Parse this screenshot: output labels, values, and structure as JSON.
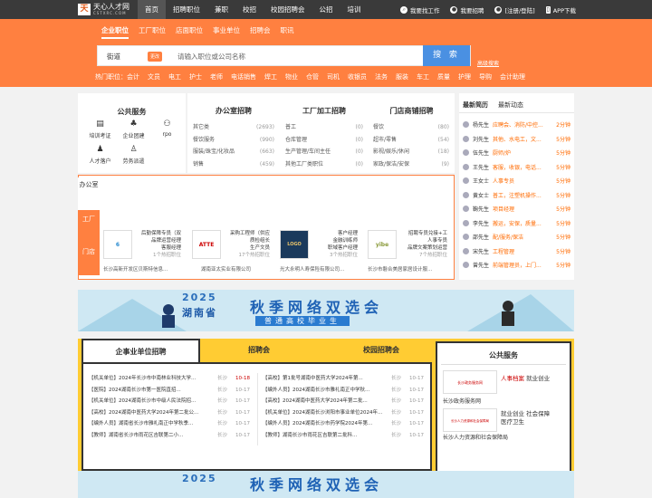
{
  "logo": {
    "mark": "天",
    "name": "天心人才网",
    "url": "CSTXRC.COM"
  },
  "nav": [
    "首页",
    "招聘职位",
    "兼职",
    "校招",
    "校园招聘会",
    "公招",
    "培训"
  ],
  "top_right": {
    "find_job": "我要找工作",
    "hire": "我要招聘",
    "login": "[注册/登陆]",
    "app": "APP下载"
  },
  "search_tabs": [
    "企业职位",
    "工厂职位",
    "店面职位",
    "事业单位",
    "招聘会",
    "职讯"
  ],
  "search": {
    "city": "街道",
    "change": "更改",
    "placeholder": "请输入职位或公司名称",
    "button": "搜 索",
    "advanced": "高级搜索"
  },
  "hot": {
    "label": "热门职位：",
    "items": [
      "会计",
      "文员",
      "电工",
      "护士",
      "老师",
      "电话销售",
      "焊工",
      "物业",
      "仓管",
      "司机",
      "收银员",
      "法务",
      "服装",
      "车工",
      "质量",
      "护理",
      "导购",
      "会计助理"
    ]
  },
  "public_service": {
    "title": "公共服务",
    "items": [
      "培训考证",
      "企业团建",
      "rpo",
      "人才落户",
      "劳务派遣"
    ]
  },
  "office": {
    "title": "办公室招聘",
    "rows": [
      [
        "其它类",
        "(2693)"
      ],
      [
        "餐饮服务",
        "(990)"
      ],
      [
        "服装/珠宝/化妆品",
        "(663)"
      ],
      [
        "销售",
        "(459)"
      ]
    ]
  },
  "factory": {
    "title": "工厂加工招聘",
    "rows": [
      [
        "普工",
        "(0)"
      ],
      [
        "仓库管理",
        "(0)"
      ],
      [
        "生产管理/车间主任",
        "(0)"
      ],
      [
        "其他工厂类职位",
        "(0)"
      ]
    ]
  },
  "shop": {
    "title": "门店商铺招聘",
    "rows": [
      [
        "餐饮",
        "(80)"
      ],
      [
        "超市/零售",
        "(54)"
      ],
      [
        "影视/娱乐/休闲",
        "(18)"
      ],
      [
        "家政/保洁/安保",
        "(9)"
      ]
    ]
  },
  "latest": {
    "tabs": [
      "最新简历",
      "最新动态"
    ],
    "rows": [
      [
        "杨先生",
        "应聘会、消防/中控...",
        "2分钟"
      ],
      [
        "刘先生",
        "其他、水电工，文...",
        "5分钟"
      ],
      [
        "伍先生",
        "厨师/炉",
        "5分钟"
      ],
      [
        "王先生",
        "客服，收银，电话...",
        "5分钟"
      ],
      [
        "王女士",
        "人事专员",
        "5分钟"
      ],
      [
        "黄女士",
        "普工，注塑机操作...",
        "5分钟"
      ],
      [
        "鞠先生",
        "项目经理",
        "5分钟"
      ],
      [
        "李先生",
        "搬运，安保，质量...",
        "5分钟"
      ],
      [
        "邵先生",
        "配/服务/保洁",
        "5分钟"
      ],
      [
        "宋先生",
        "工程管理",
        "5分钟"
      ],
      [
        "曾先生",
        "前端管理员，上门...",
        "5分钟"
      ]
    ]
  },
  "vertical_tabs": [
    "办公室",
    "工厂",
    "门店"
  ],
  "companies": [
    {
      "logo": "6",
      "lines": [
        "后勤保障专员（双",
        "品牌运营经理",
        "客服经理"
      ],
      "more": "1个热招职位",
      "name": "长沙高新开发区贝斯特信息..."
    },
    {
      "logo": "ATTE",
      "lines": [
        "采购工程师（供应",
        "质检组长",
        "生产文员"
      ],
      "more": "17个热招职位",
      "name": "湖南亚太实业有限公司"
    },
    {
      "logo": "LOGO",
      "lines": [
        "客户经理",
        "金融训练师",
        "职域客户经理"
      ],
      "more": "3个热招职位",
      "name": "光大永明人寿保险有限公司..."
    },
    {
      "logo": "yibe",
      "lines": [
        "招聘专员兑接+工",
        "人事专员",
        "品牌文案策划运营"
      ],
      "more": "7个热招职位",
      "name": "长沙市磐合美居家居设计服..."
    }
  ],
  "banner": {
    "year": "2025",
    "province": "湖南省",
    "title": "秋季网络双选会",
    "subtitle": "普通高校毕业生"
  },
  "news_tabs": [
    "企事业单位招聘",
    "招聘会",
    "校园招聘会"
  ],
  "news_left": [
    [
      "【机关单位】2024年长沙市中南林业科技大学...",
      "长沙",
      "10-18"
    ],
    [
      "【医院】2024湖南长沙市第一医院直招...",
      "长沙",
      "10-17"
    ],
    [
      "【机关单位】2024湖南长沙市中级人民法院招...",
      "长沙",
      "10-17"
    ],
    [
      "【高校】2024湖南中医药大学2024年第二批公...",
      "长沙",
      "10-17"
    ],
    [
      "【编外人员】湖南省长沙市雅礼南正中学秋季...",
      "长沙",
      "10-17"
    ],
    [
      "【教师】湖南省长沙市雨花区吉联第二小...",
      "长沙",
      "10-17"
    ]
  ],
  "news_right": [
    [
      "【高校】第1批号湖南中医药大学2024年第...",
      "长沙",
      "10-17"
    ],
    [
      "【编外人员】2024湖南长沙市雅礼南正中学秋...",
      "长沙",
      "10-17"
    ],
    [
      "【高校】2024湖南中医药大学2024年第二批...",
      "长沙",
      "10-17"
    ],
    [
      "【机关单位】2024湖南长沙浏阳市事业单位2024年...",
      "长沙",
      "10-17"
    ],
    [
      "【编外人员】2024湖南长沙市药学院2024年第...",
      "长沙",
      "10-17"
    ],
    [
      "【教师】湖南长沙市雨花区吉联第二批科...",
      "长沙",
      "10-17"
    ]
  ],
  "public_service2": {
    "title": "公共服务",
    "items": [
      {
        "logo": "长沙政务服务网",
        "caption": "长沙政务服务网",
        "tags": [
          "人事档案",
          "就业创业"
        ]
      },
      {
        "logo": "长沙人力资源和社会保障局",
        "caption": "长沙人力资源和社会保障局",
        "tags": [
          "就业创业",
          "社会保障",
          "医疗卫生"
        ]
      }
    ]
  }
}
